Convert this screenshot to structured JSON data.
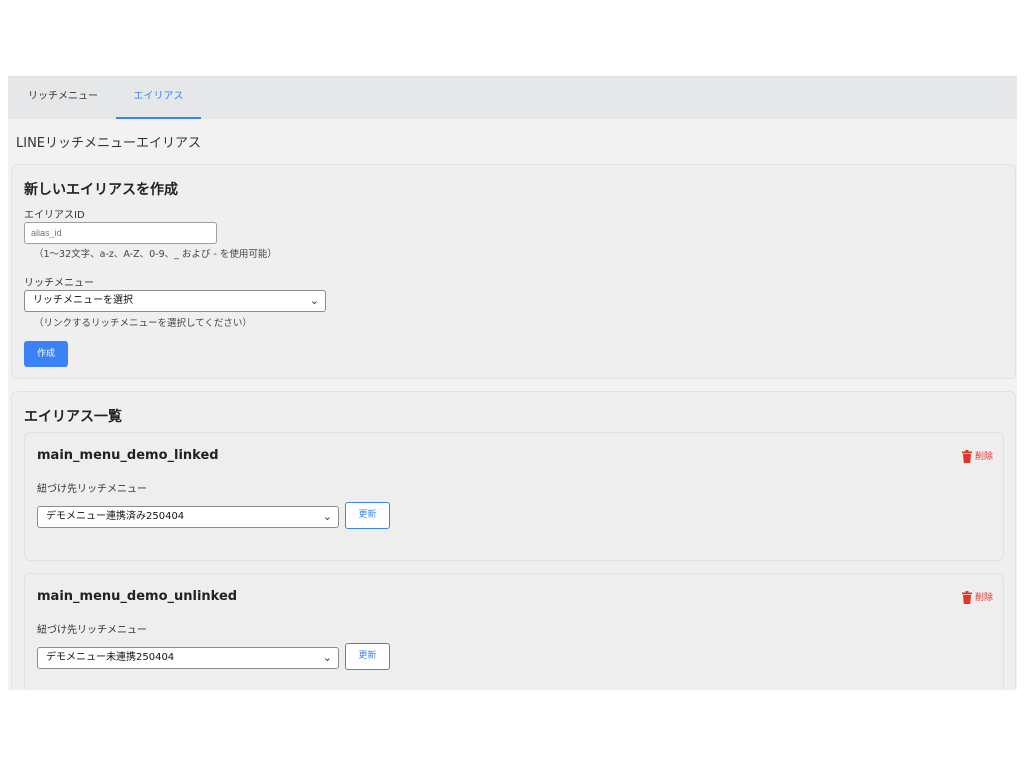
{
  "tabs": [
    {
      "label": "リッチメニュー"
    },
    {
      "label": "エイリアス"
    }
  ],
  "page_title": "LINEリッチメニューエイリアス",
  "create": {
    "heading": "新しいエイリアスを作成",
    "alias_label": "エイリアスID",
    "alias_placeholder": "alias_id",
    "alias_help": "（1〜32文字、a-z、A-Z、0-9、_ および - を使用可能）",
    "menu_label": "リッチメニュー",
    "menu_selected": "リッチメニューを選択",
    "menu_help": "（リンクするリッチメニューを選択してください）",
    "submit_label": "作成"
  },
  "list": {
    "heading": "エイリアス一覧",
    "items": [
      {
        "name": "main_menu_demo_linked",
        "delete_label": "削除",
        "linked_label": "紐づけ先リッチメニュー",
        "selected": "デモメニュー連携済み250404",
        "update_label": "更新"
      },
      {
        "name": "main_menu_demo_unlinked",
        "delete_label": "削除",
        "linked_label": "紐づけ先リッチメニュー",
        "selected": "デモメニュー未連携250404",
        "update_label": "更新"
      }
    ]
  },
  "colors": {
    "accent": "#3b82f6",
    "danger": "#e0362b"
  },
  "icons": {
    "delete": "trash-icon",
    "dropdown": "chevron-down-icon"
  }
}
